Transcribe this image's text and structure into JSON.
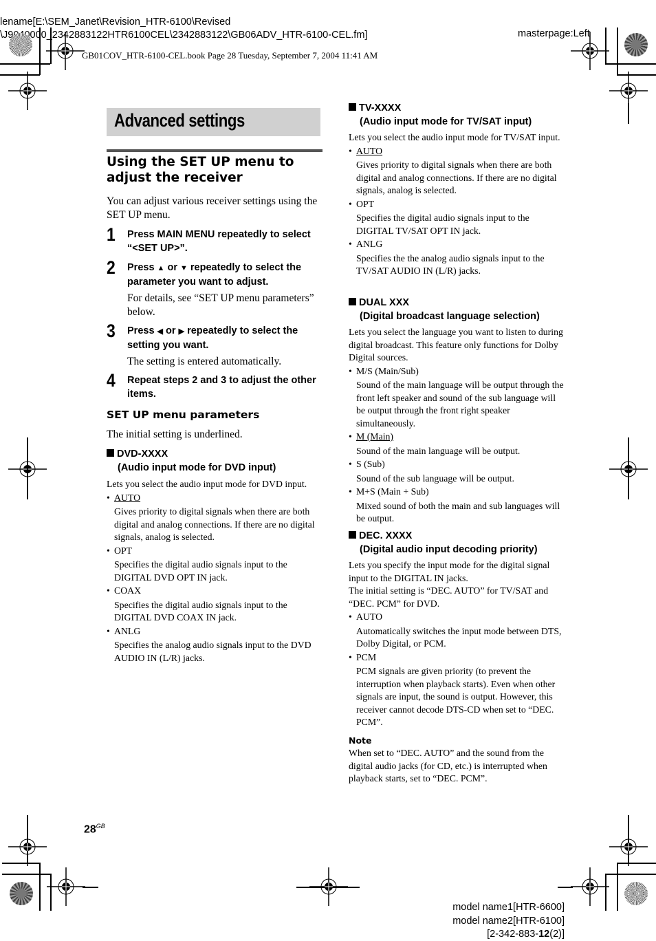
{
  "meta": {
    "filename_line1": "lename[E:\\SEM_Janet\\Revision_HTR-6100\\Revised",
    "filename_line2": "\\J9040000_2342883122HTR6100CEL\\2342883122\\GB06ADV_HTR-6100-CEL.fm]",
    "masterpage": "masterpage:Left",
    "book_line": "GB01COV_HTR-6100-CEL.book  Page 28  Tuesday, September 7, 2004  11:41 AM",
    "model_name1": "model name1[HTR-6600]",
    "model_name2": "model name2[HTR-6100]",
    "part_prefix": "[2-342-883-",
    "part_bold": "12",
    "part_suffix": "(2)]"
  },
  "page": {
    "section_title": "Advanced settings",
    "heading": "Using the SET UP menu to adjust the receiver",
    "intro": "You can adjust various receiver settings using the SET UP menu.",
    "page_number": "28",
    "page_suffix": "GB"
  },
  "steps": [
    {
      "num": "1",
      "text": "Press MAIN MENU repeatedly to select “<SET UP>”.",
      "sub": ""
    },
    {
      "num": "2",
      "text_pre": "Press ",
      "icon1": "▲",
      "mid": " or ",
      "icon2": "▼",
      "text_post": " repeatedly to select the parameter you want to adjust.",
      "sub": "For details, see “SET UP menu parameters” below."
    },
    {
      "num": "3",
      "text_pre": "Press ",
      "icon1": "◀",
      "mid": " or ",
      "icon2": "▶",
      "text_post": " repeatedly to select the setting you want.",
      "sub": "The setting is entered automatically."
    },
    {
      "num": "4",
      "text": "Repeat steps 2 and 3 to adjust the other items.",
      "sub": ""
    }
  ],
  "params_heading": "SET UP menu parameters",
  "params_intro": "The initial setting is underlined.",
  "params": {
    "dvd": {
      "name": "DVD-XXXX",
      "subtitle": "(Audio input mode for DVD input)",
      "desc": "Lets you select the audio input mode for DVD input.",
      "options": [
        {
          "label": "AUTO",
          "underlined": true,
          "desc": "Gives priority to digital signals when there are both digital and analog connections. If there are no digital signals, analog is selected."
        },
        {
          "label": "OPT",
          "underlined": false,
          "desc": "Specifies the digital audio signals input to the DIGITAL DVD OPT IN jack."
        },
        {
          "label": "COAX",
          "underlined": false,
          "desc": "Specifies the digital audio signals input to the DIGITAL DVD COAX IN jack."
        },
        {
          "label": "ANLG",
          "underlined": false,
          "desc": "Specifies the analog audio signals input to the DVD AUDIO IN (L/R) jacks."
        }
      ]
    },
    "tv": {
      "name": "TV-XXXX",
      "subtitle": "(Audio input mode for TV/SAT input)",
      "desc": "Lets you select the audio input mode for TV/SAT input.",
      "options": [
        {
          "label": "AUTO",
          "underlined": true,
          "desc": "Gives priority to digital signals when there are both digital and analog connections. If there are no digital signals, analog is selected."
        },
        {
          "label": "OPT",
          "underlined": false,
          "desc": "Specifies the digital audio signals input to the DIGITAL TV/SAT OPT IN jack."
        },
        {
          "label": "ANLG",
          "underlined": false,
          "desc": "Specifies the the analog audio signals input to the TV/SAT AUDIO IN (L/R) jacks."
        }
      ]
    },
    "dual": {
      "name": "DUAL XXX",
      "subtitle": "(Digital broadcast language selection)",
      "desc": "Lets you select the language you want to listen to during digital broadcast. This feature only functions for Dolby Digital sources.",
      "options": [
        {
          "label": "M/S (Main/Sub)",
          "underlined": false,
          "desc": "Sound of the main language will be output through the front left speaker and sound of the sub language will be output through the front right speaker simultaneously."
        },
        {
          "label": "M (Main)",
          "underlined": true,
          "desc": "Sound of the main language will be output."
        },
        {
          "label": "S (Sub)",
          "underlined": false,
          "desc": "Sound of the sub language will be output."
        },
        {
          "label": "M+S (Main + Sub)",
          "underlined": false,
          "desc": "Mixed sound of both the main and sub languages will be output."
        }
      ]
    },
    "dec": {
      "name": "DEC. XXXX",
      "subtitle": "(Digital audio input decoding priority)",
      "desc": "Lets you specify the input mode for the digital signal input to the DIGITAL IN jacks.",
      "desc2": "The initial setting is “DEC. AUTO” for TV/SAT and “DEC. PCM” for DVD.",
      "options": [
        {
          "label": "AUTO",
          "underlined": false,
          "desc": "Automatically switches the input mode between DTS, Dolby Digital, or PCM."
        },
        {
          "label": "PCM",
          "underlined": false,
          "desc": "PCM signals are given priority (to prevent the interruption when playback starts). Even when other signals are input, the sound is output. However, this receiver cannot decode DTS-CD when set to “DEC. PCM”."
        }
      ]
    }
  },
  "note": {
    "label": "Note",
    "text": "When set to “DEC. AUTO” and the sound from the digital audio jacks (for CD, etc.) is interrupted when playback starts, set to “DEC. PCM”."
  }
}
